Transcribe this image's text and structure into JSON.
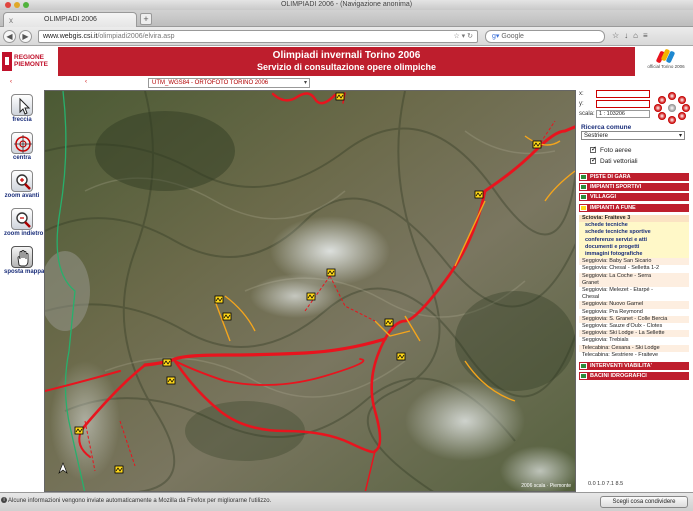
{
  "window": {
    "title": "OLIMPIADI 2006 - (Navigazione anonima)"
  },
  "tab": {
    "title": "OLIMPIADI 2006",
    "close": "x",
    "new_tab": "+"
  },
  "nav": {
    "url_host": "www.webgis.csi.it",
    "url_path": "/olimpiadi2006/elvira.asp",
    "search_placeholder": "Google"
  },
  "header": {
    "logo_line1": "REGIONE",
    "logo_line2": "PIEMONTE",
    "title": "Olimpiadi invernali Torino 2006",
    "subtitle": "Servizio di consultazione opere olimpiche",
    "olympic_text": "official Torino 2006"
  },
  "toolbar": {
    "layer_select": "UTM_WGS84 - ORTOFOTO TORINO 2006",
    "marker_left": "‹",
    "marker_right": "‹"
  },
  "tools": [
    {
      "label": "freccia"
    },
    {
      "label": "centra"
    },
    {
      "label": "zoom avanti"
    },
    {
      "label": "zoom indietro"
    },
    {
      "label": "sposta mappa"
    }
  ],
  "map": {
    "copyright": "2006 scala · Piemonte"
  },
  "panel": {
    "x_label": "x:",
    "y_label": "y:",
    "scale_label": "scala:",
    "scale_value": "1 : 103206",
    "search_label": "Ricerca comune",
    "search_value": "Sestriere",
    "checkbox_foto": "Foto aeree",
    "checkbox_dati": "Dati vettoriali",
    "categories": [
      "PISTE DI GARA",
      "IMPIANTI SPORTIVI",
      "VILLAGGI",
      "IMPIANTI A FUNE"
    ],
    "items": [
      {
        "text": "Sciovia: Fraiteve 3",
        "kind": "hl"
      },
      {
        "text": "schede tecniche",
        "kind": "sub"
      },
      {
        "text": "schede tecniche sportive",
        "kind": "sub"
      },
      {
        "text": "conferenze servizi e atti",
        "kind": "sub"
      },
      {
        "text": "documenti e progetti",
        "kind": "sub"
      },
      {
        "text": "immagini fotografiche",
        "kind": "sub"
      },
      {
        "text": "Seggiovia: Baby San Sicario",
        "kind": "alt"
      },
      {
        "text": "Seggiovia: Chesal - Selletta 1-2",
        "kind": ""
      },
      {
        "text": "Seggiovia: La Coche - Serra",
        "kind": "alt"
      },
      {
        "text": "Granet",
        "kind": "alt"
      },
      {
        "text": "Seggiovia: Melezet - Etarpé -",
        "kind": ""
      },
      {
        "text": "Chesal",
        "kind": ""
      },
      {
        "text": "Seggiovia: Nuovo Garnel",
        "kind": "alt"
      },
      {
        "text": "Seggiovia: Pra Reymond",
        "kind": ""
      },
      {
        "text": "Seggiovia: S. Granet - Colle Bercia",
        "kind": "alt"
      },
      {
        "text": "Seggiovia: Sauze d'Oulx - Clotes",
        "kind": ""
      },
      {
        "text": "Seggiovia: Ski Lodge - La Sellette",
        "kind": "alt"
      },
      {
        "text": "Seggiovia: Trebials",
        "kind": ""
      },
      {
        "text": "Telecabina: Cesana - Ski Lodge",
        "kind": "alt"
      },
      {
        "text": "Telecabina: Sestriere - Fraiteve",
        "kind": ""
      }
    ],
    "bottom_categories": [
      "INTERVENTI VIABILITA'",
      "BACINI IDROGRAFICI"
    ]
  },
  "status": {
    "message": "Alcune informazioni vengono inviate automaticamente a Mozilla da Firefox per migliorarne l'utilizzo.",
    "share_button": "Scegli cosa condividere",
    "icons_text": "0.0  1.0  7.1  8.5"
  },
  "colors": {
    "brand_red": "#be1e2d",
    "route_red": "#e8141e",
    "text_blue": "#1a2e7a"
  }
}
